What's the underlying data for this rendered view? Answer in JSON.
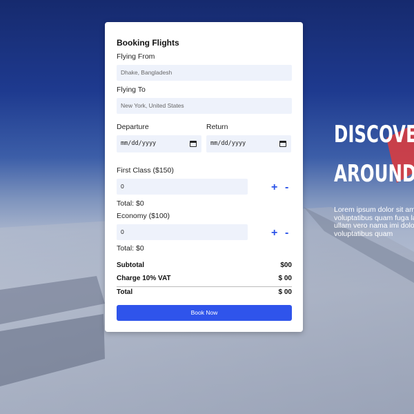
{
  "hero": {
    "line1": "DISCOVER",
    "line2": "AROUND",
    "text_lines": [
      "Lorem ipsum dolor sit amet",
      "voluptatibus quam fuga labo",
      "ullam vero nama imi dolor",
      "voluptatibus quam"
    ]
  },
  "form": {
    "title": "Booking Flights",
    "flying_from_label": "Flying From",
    "flying_from_placeholder": "Dhake, Bangladesh",
    "flying_to_label": "Flying To",
    "flying_to_placeholder": "New York, United States",
    "departure_label": "Departure",
    "return_label": "Return",
    "date_placeholder": "mm/dd/yyyy",
    "first_class_label": "First Class ($150)",
    "first_class_qty": "0",
    "first_class_total": "Total: $0",
    "economy_label": "Economy ($100)",
    "economy_qty": "0",
    "economy_total": "Total: $0",
    "plus": "+",
    "minus": "-",
    "subtotal_label": "Subtotal",
    "subtotal_value": "$00",
    "vat_label": "Charge 10% VAT",
    "vat_value": "$ 00",
    "total_label": "Total",
    "total_value": "$ 00",
    "book_button": "Book Now"
  },
  "colors": {
    "accent": "#2f54eb",
    "field_bg": "#eef2fb"
  }
}
